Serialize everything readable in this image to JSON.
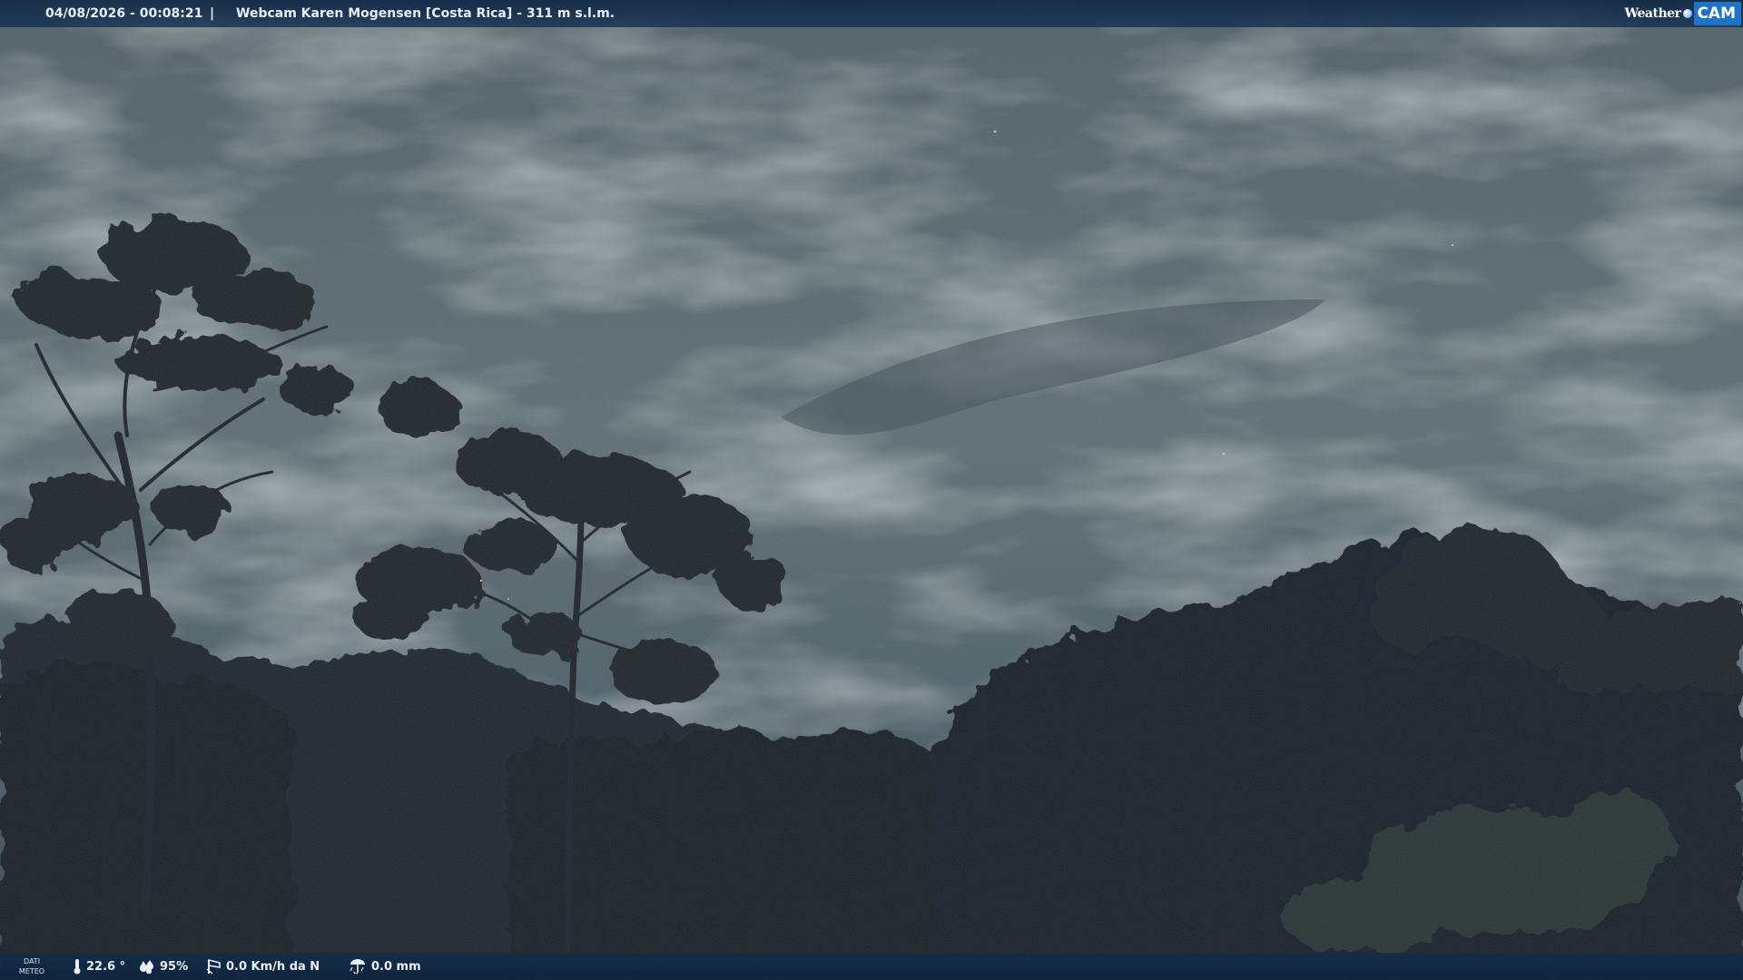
{
  "header": {
    "datetime": "04/08/2026 - 00:08:21",
    "separator": "|",
    "title": "Webcam Karen Mogensen [Costa Rica]  - 311 m s.l.m."
  },
  "logo": {
    "weather_text": "Weather",
    "cam_text": "CAM",
    "accent_color": "#1f74c8"
  },
  "footer": {
    "dati_label_1": "DATI",
    "dati_label_2": "METEO",
    "temperature": "22.6 °",
    "humidity": "95%",
    "wind": "0.0 Km/h da N",
    "rain": "0.0 mm"
  },
  "icons": {
    "temperature": "thermometer-icon",
    "humidity": "droplets-icon",
    "wind": "wind-icon",
    "rain": "rain-gauge-icon"
  },
  "colors": {
    "bar_background": "#14304f",
    "text": "#e9eef4",
    "sky": "#5a6a72",
    "foliage": "#141a22"
  }
}
